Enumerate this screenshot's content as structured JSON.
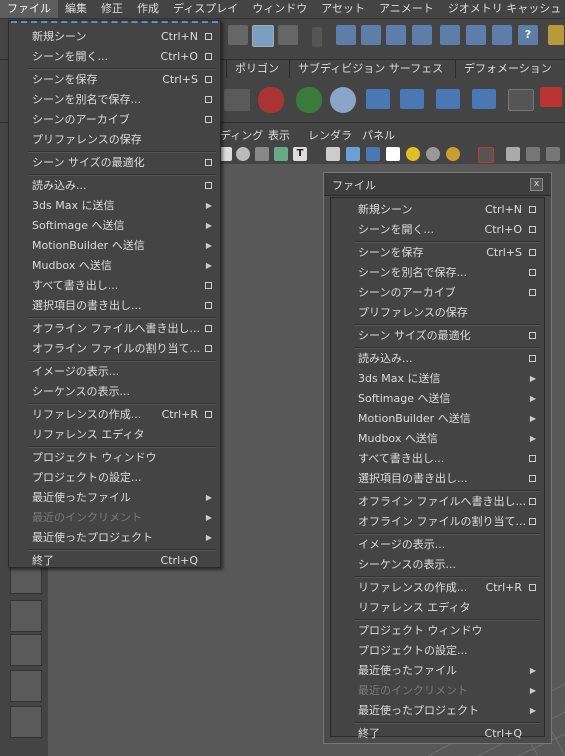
{
  "menubar": [
    "ファイル",
    "編集",
    "修正",
    "作成",
    "ディスプレイ",
    "ウィンドウ",
    "アセット",
    "アニメート",
    "ジオメトリ キャッシュ"
  ],
  "shelf_tabs": [
    "ポリゴン",
    "サブディビジョン サーフェス",
    "デフォメーション"
  ],
  "panel_menus": [
    "ディング",
    "表示",
    "レンダラ",
    "パネル"
  ],
  "torn_window": {
    "title": "ファイル",
    "close": "x"
  },
  "file_menu": [
    {
      "label": "新規シーン",
      "shortcut": "Ctrl+N",
      "option": true
    },
    {
      "label": "シーンを開く...",
      "shortcut": "Ctrl+O",
      "option": true
    },
    {
      "separator": true
    },
    {
      "label": "シーンを保存",
      "shortcut": "Ctrl+S",
      "option": true
    },
    {
      "label": "シーンを別名で保存...",
      "shortcut": "",
      "option": true
    },
    {
      "label": "シーンのアーカイブ",
      "shortcut": "",
      "option": true
    },
    {
      "label": "プリファレンスの保存",
      "shortcut": "",
      "option": false
    },
    {
      "separator": true
    },
    {
      "label": "シーン サイズの最適化",
      "shortcut": "",
      "option": true
    },
    {
      "separator": true
    },
    {
      "label": "読み込み...",
      "shortcut": "",
      "option": true
    },
    {
      "label": "3ds Max に送信",
      "shortcut": "",
      "submenu": true
    },
    {
      "label": "Softimage へ送信",
      "shortcut": "",
      "submenu": true
    },
    {
      "label": "MotionBuilder へ送信",
      "shortcut": "",
      "submenu": true
    },
    {
      "label": "Mudbox へ送信",
      "shortcut": "",
      "submenu": true
    },
    {
      "label": "すべて書き出し...",
      "shortcut": "",
      "option": true
    },
    {
      "label": "選択項目の書き出し...",
      "shortcut": "",
      "option": true
    },
    {
      "separator": true
    },
    {
      "label": "オフライン ファイルへ書き出し...",
      "shortcut": "",
      "option": true
    },
    {
      "label": "オフライン ファイルの割り当て...",
      "shortcut": "",
      "option": true
    },
    {
      "separator": true
    },
    {
      "label": "イメージの表示...",
      "shortcut": ""
    },
    {
      "label": "シーケンスの表示...",
      "shortcut": ""
    },
    {
      "separator": true
    },
    {
      "label": "リファレンスの作成...",
      "shortcut": "Ctrl+R",
      "option": true
    },
    {
      "label": "リファレンス エディタ",
      "shortcut": ""
    },
    {
      "separator": true
    },
    {
      "label": "プロジェクト ウィンドウ",
      "shortcut": ""
    },
    {
      "label": "プロジェクトの設定...",
      "shortcut": ""
    },
    {
      "label": "最近使ったファイル",
      "shortcut": "",
      "submenu": true
    },
    {
      "label": "最近のインクリメント",
      "shortcut": "",
      "submenu": true,
      "disabled": true
    },
    {
      "label": "最近使ったプロジェクト",
      "shortcut": "",
      "submenu": true
    },
    {
      "separator": true
    },
    {
      "label": "終了",
      "shortcut": "Ctrl+Q"
    }
  ],
  "colors": {
    "background": "#444444",
    "viewport": "#585858",
    "tear_line": "#5b8fcf",
    "disabled_text": "#7a7a7a"
  }
}
